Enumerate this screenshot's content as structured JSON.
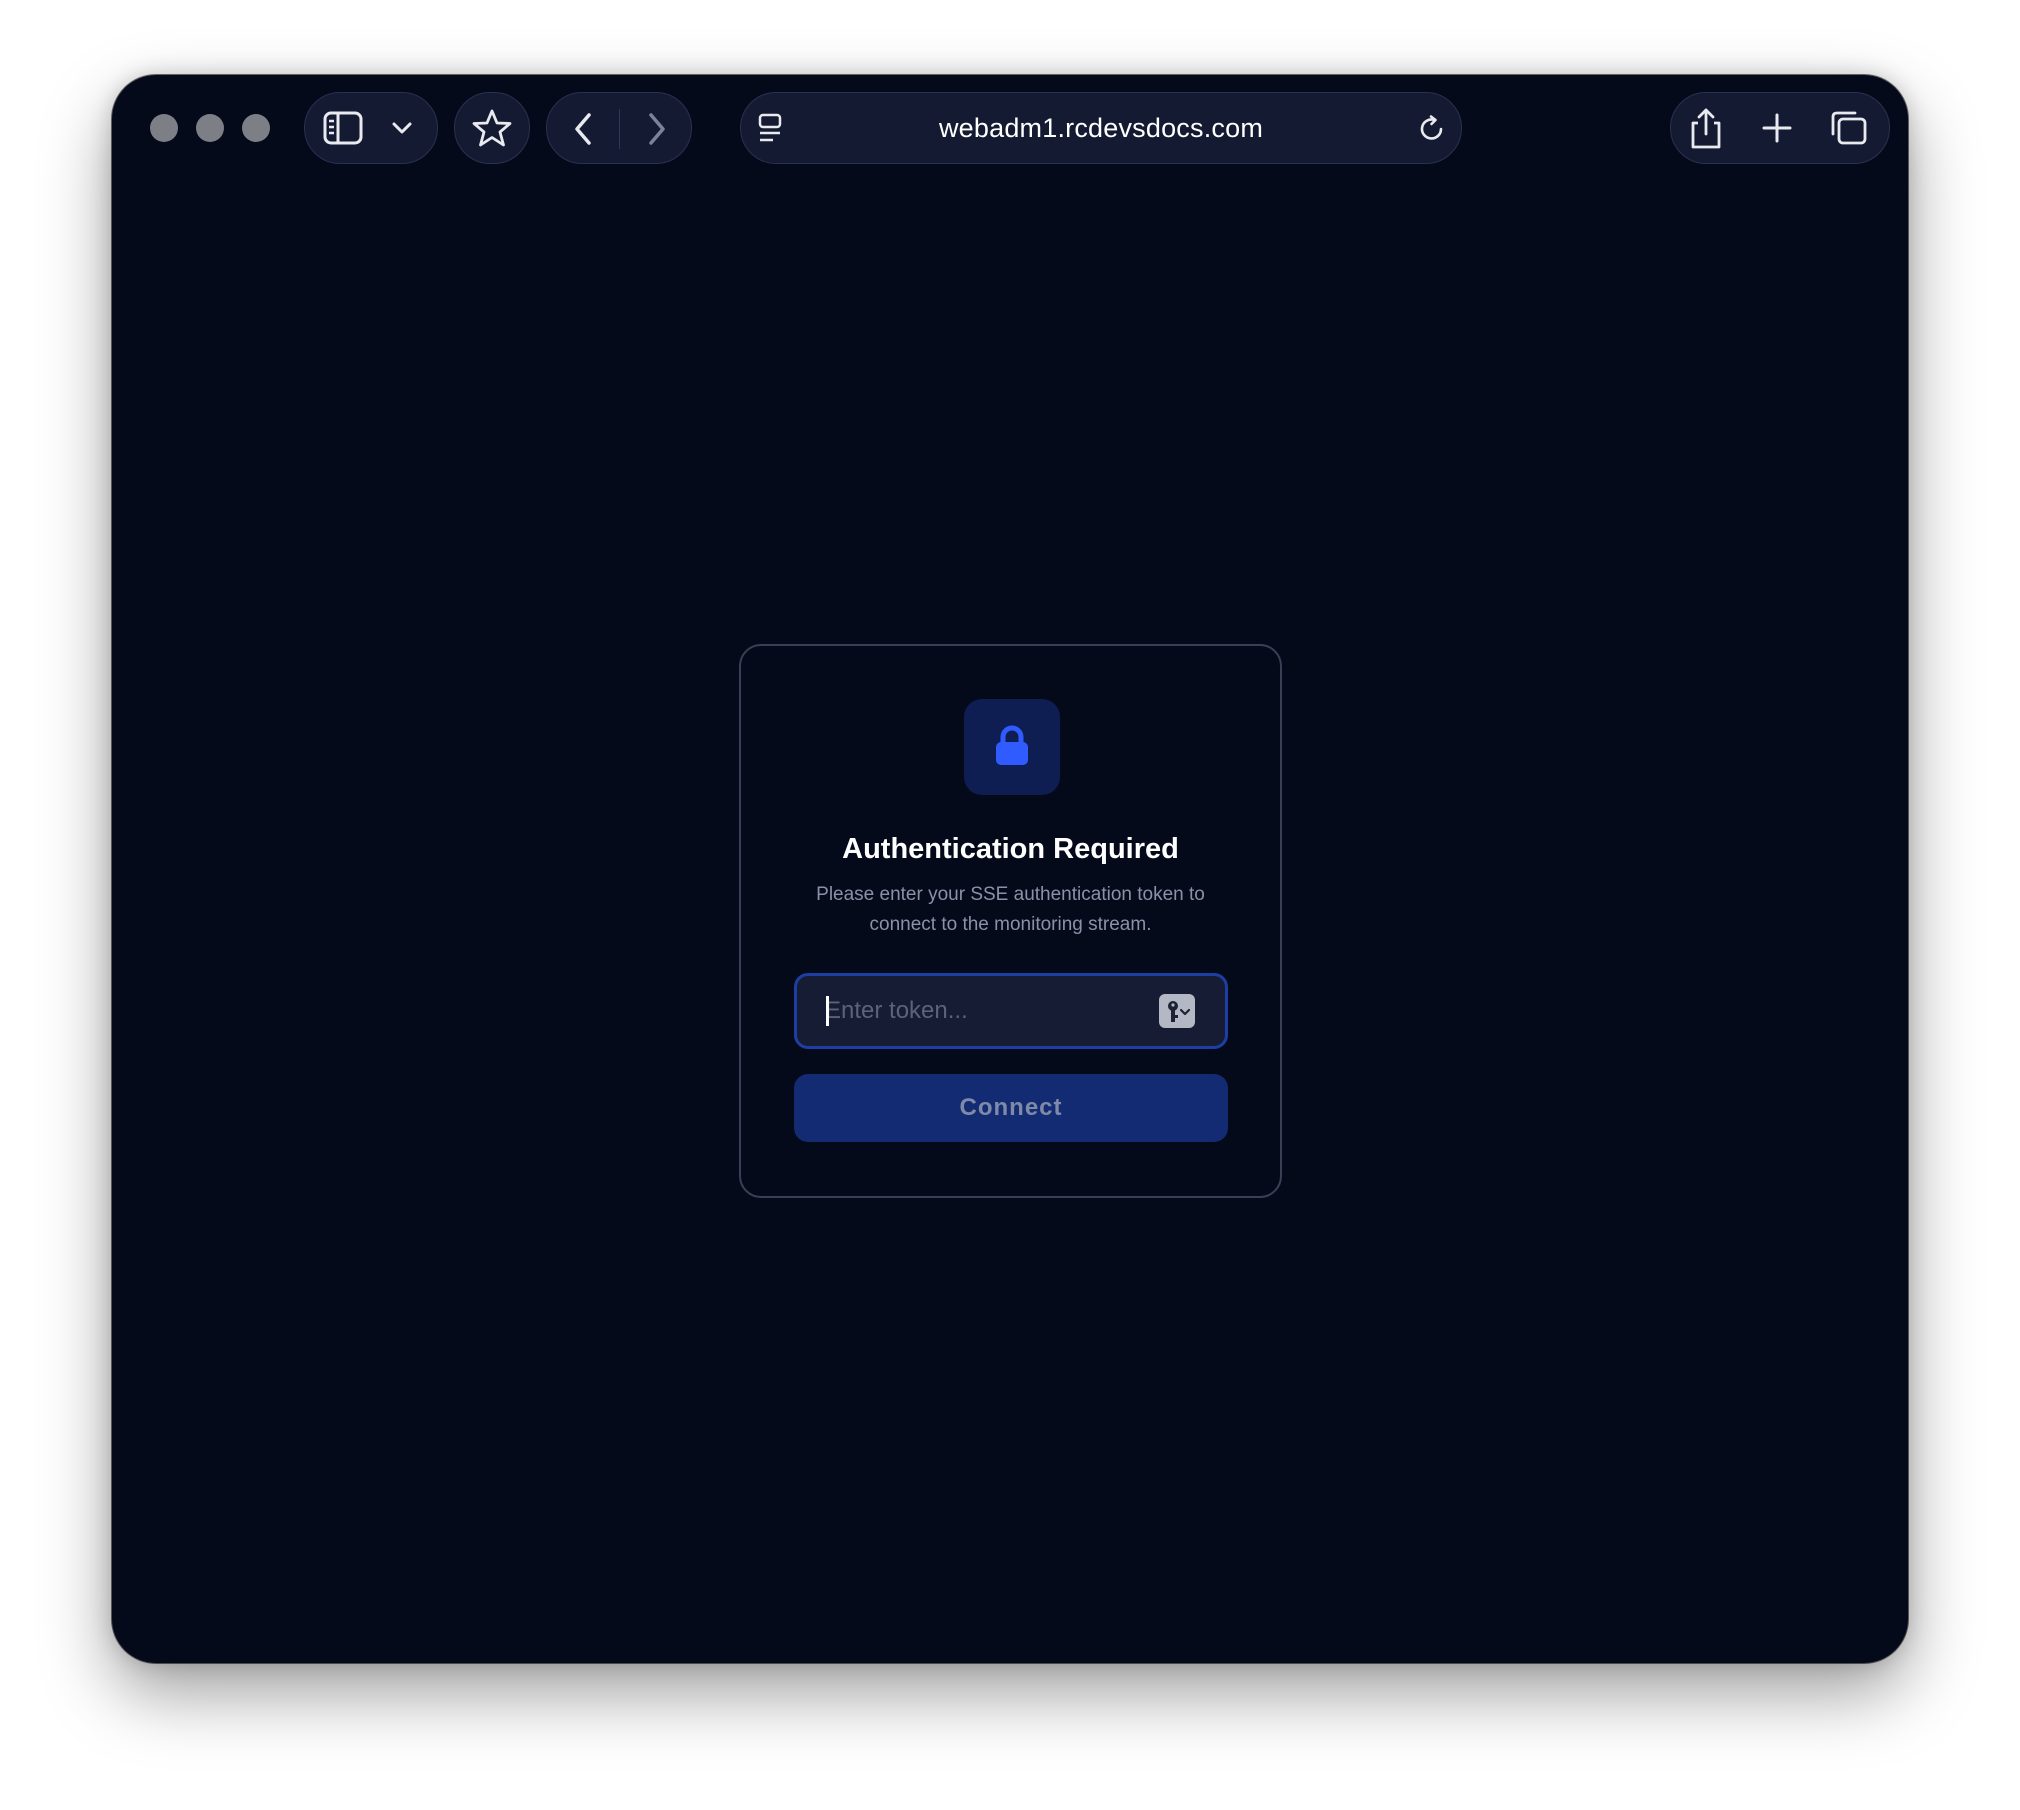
{
  "browser": {
    "url": "webadm1.rcdevsdocs.com"
  },
  "auth_card": {
    "title": "Authentication Required",
    "description": "Please enter your SSE authentication token to connect to the monitoring stream.",
    "token_input": {
      "value": "",
      "placeholder": "Enter token..."
    },
    "connect_label": "Connect"
  },
  "colors": {
    "page_background": "#050a1b",
    "accent_blue": "#2f5bff",
    "button_background": "#132b72",
    "field_border": "#1d3ea3"
  },
  "icons": [
    "sidebar-icon",
    "chevron-down-icon",
    "star-icon",
    "back-icon",
    "forward-icon",
    "page-menu-icon",
    "reload-icon",
    "share-icon",
    "plus-icon",
    "tabs-icon",
    "lock-icon",
    "key-icon"
  ]
}
